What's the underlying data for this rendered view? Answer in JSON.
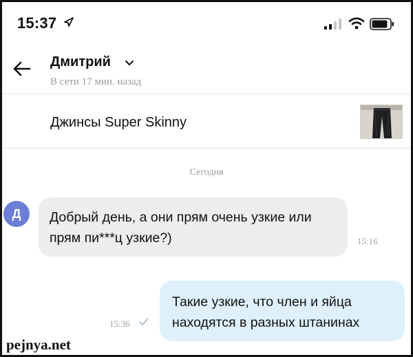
{
  "status_bar": {
    "time": "15:37",
    "location_icon": "location-arrow-icon",
    "signal_icon": "cellular-signal-icon",
    "wifi_icon": "wifi-icon",
    "battery_icon": "battery-icon"
  },
  "header": {
    "contact_name": "Дмитрий",
    "presence": "В сети 17 мин. назад",
    "back_icon": "back-arrow-icon",
    "chevron_icon": "chevron-down-icon"
  },
  "listing": {
    "title": "Джинсы Super Skinny",
    "thumbnail": "jeans-photo"
  },
  "date_separator": "Сегодня",
  "messages": [
    {
      "direction": "incoming",
      "avatar_letter": "Д",
      "text": "Добрый день, а они прям очень узкие или прям пи***ц узкие?)",
      "time": "15:16"
    },
    {
      "direction": "outgoing",
      "text": "Такие узкие, что член и яйца находятся в разных штанинах",
      "time": "15:36",
      "read_icon": "check-icon"
    }
  ],
  "watermark": "pejnya.net",
  "colors": {
    "avatar": "#6b7fd6",
    "incoming_bubble": "#ededed",
    "outgoing_bubble": "#def0fb",
    "muted_text": "#9a9a9a"
  }
}
